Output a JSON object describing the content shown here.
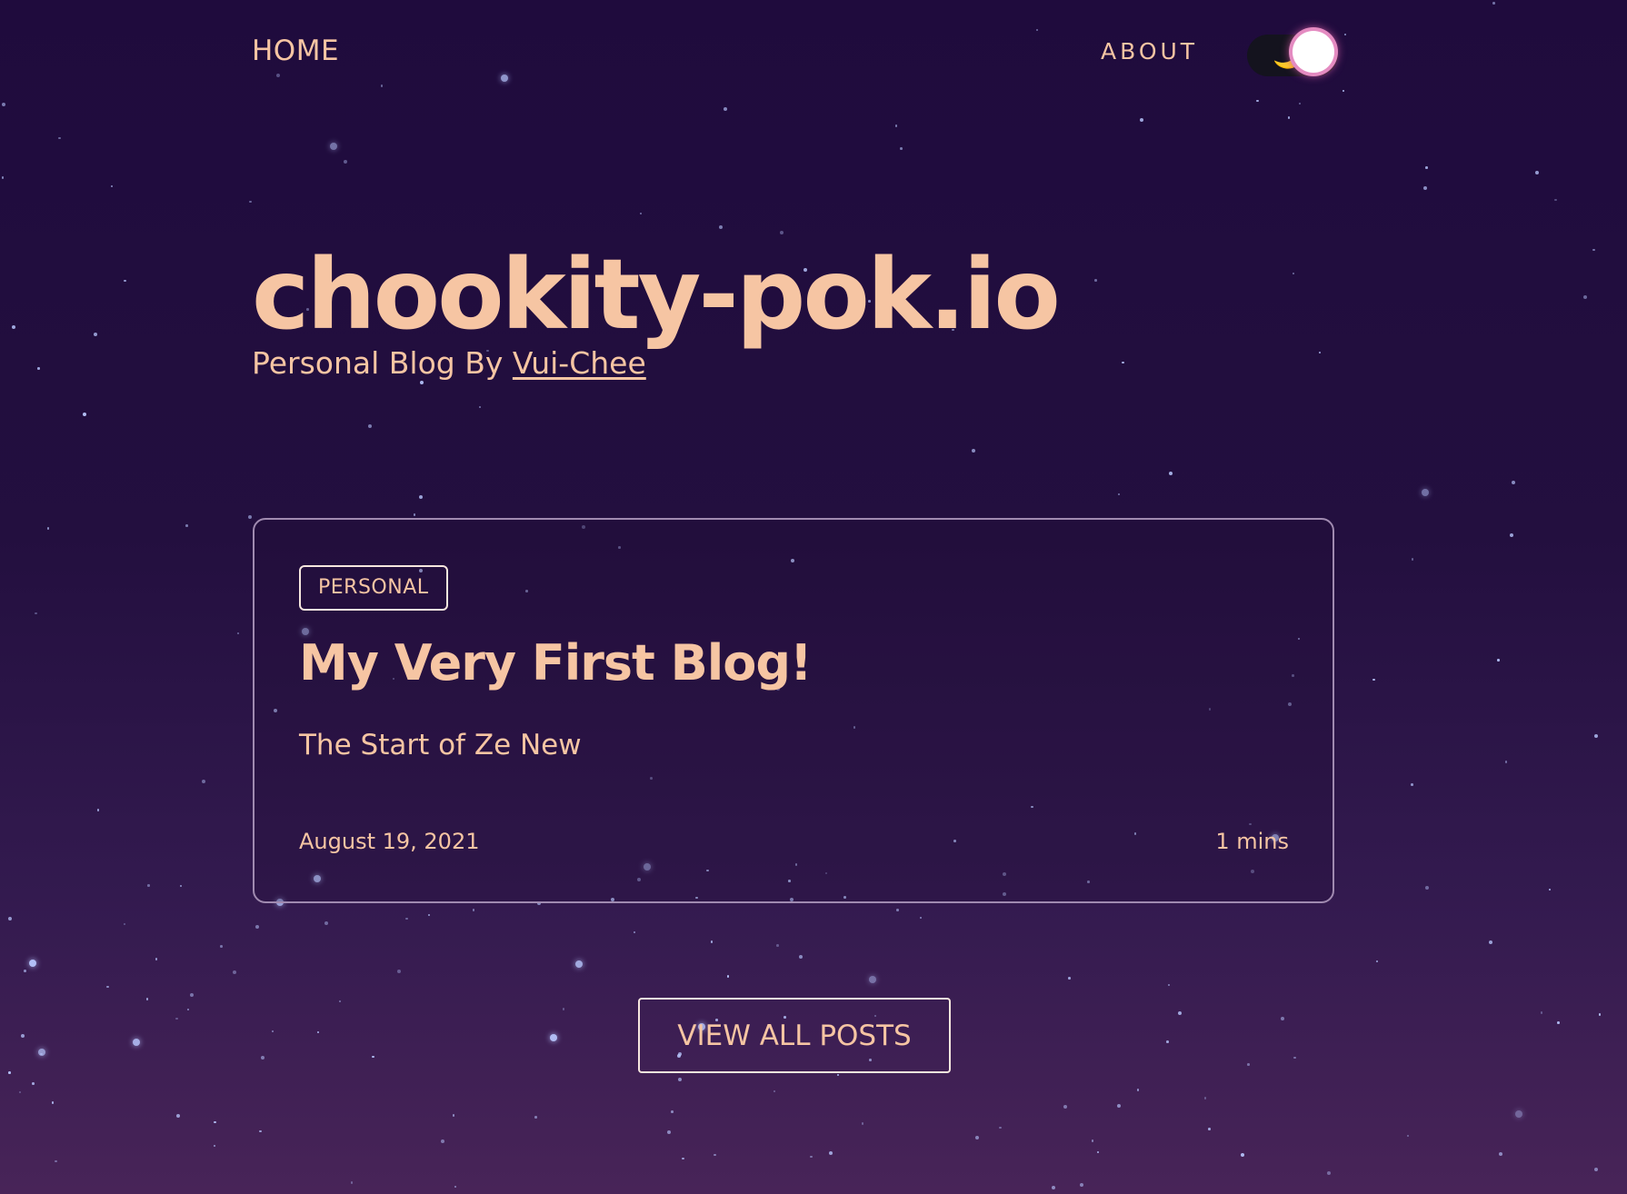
{
  "nav": {
    "home_label": "HOME",
    "about_label": "ABOUT",
    "theme_toggle": {
      "icon": "moon-icon",
      "glyph": "🌙",
      "mode": "dark"
    }
  },
  "hero": {
    "title": "chookity-pok.io",
    "tagline_prefix": "Personal Blog By ",
    "author": "Vui-Chee"
  },
  "posts": [
    {
      "tag": "PERSONAL",
      "title": "My Very First Blog!",
      "description": "The Start of Ze New",
      "date": "August 19, 2021",
      "read_time": "1 mins"
    }
  ],
  "view_all_label": "VIEW ALL POSTS",
  "colors": {
    "background_top": "#1f0b3d",
    "background_bottom": "#482458",
    "accent_text": "#f6c5a3",
    "card_border": "#a08ab0",
    "star": "#b9c8ff",
    "toggle_glow": "#e48bc1"
  }
}
